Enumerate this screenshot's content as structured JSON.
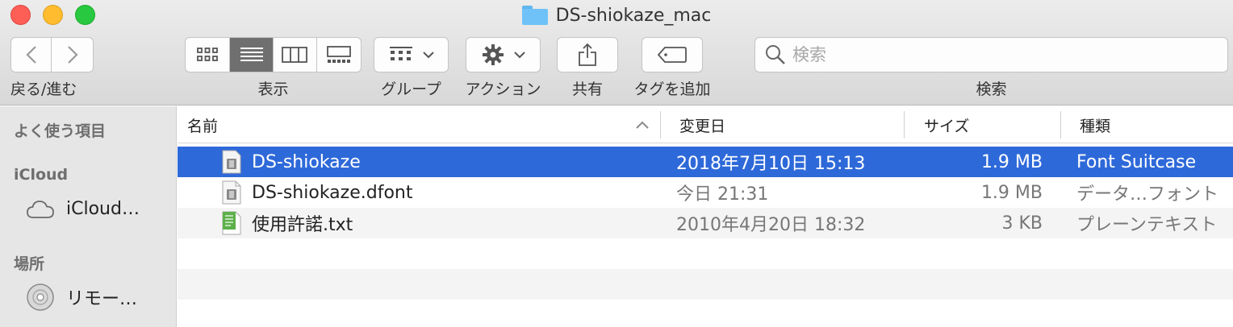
{
  "window": {
    "title": "DS-shiokaze_mac"
  },
  "toolbar": {
    "nav_label": "戻る/進む",
    "view_label": "表示",
    "group_label": "グループ",
    "action_label": "アクション",
    "share_label": "共有",
    "tag_label": "タグを追加",
    "search_label": "検索",
    "search_placeholder": "検索"
  },
  "sidebar": {
    "favorites_header": "よく使う項目",
    "icloud_header": "iCloud",
    "icloud_item": "iCloud…",
    "places_header": "場所",
    "remote_item": "リモー…"
  },
  "columns": {
    "name": "名前",
    "date": "変更日",
    "size": "サイズ",
    "kind": "種類"
  },
  "files": [
    {
      "name": "DS-shiokaze",
      "date": "2018年7月10日 15:13",
      "size": "1.9 MB",
      "kind": "Font Suitcase",
      "icon": "font-suitcase-icon",
      "selected": true
    },
    {
      "name": "DS-shiokaze.dfont",
      "date": "今日 21:31",
      "size": "1.9 MB",
      "kind": "データ…フォント",
      "icon": "font-file-icon",
      "selected": false
    },
    {
      "name": "使用許諾.txt",
      "date": "2010年4月20日 18:32",
      "size": "3 KB",
      "kind": "プレーンテキスト",
      "icon": "text-file-icon",
      "selected": false
    }
  ],
  "colors": {
    "selection": "#2e69d9",
    "close": "#fd5f57",
    "minimize": "#febc2e",
    "maximize": "#28c840"
  }
}
